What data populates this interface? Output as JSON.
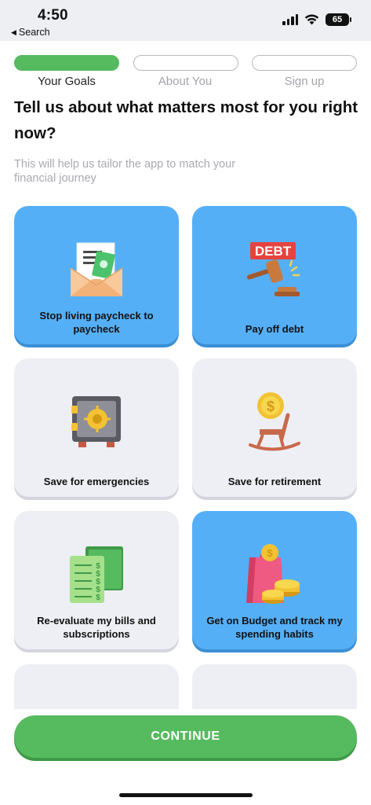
{
  "status_bar": {
    "time": "4:50",
    "back_label": "Search",
    "battery": "65"
  },
  "steps": [
    {
      "label": "Your Goals",
      "active": true
    },
    {
      "label": "About You",
      "active": false
    },
    {
      "label": "Sign up",
      "active": false
    }
  ],
  "heading": "Tell us about what matters most for you right now?",
  "subtitle": "This will help us tailor the app to match your financial journey",
  "goals": [
    {
      "label": "Stop living paycheck to paycheck",
      "selected": true,
      "icon": "money-envelope-icon"
    },
    {
      "label": "Pay off debt",
      "selected": true,
      "icon": "debt-gavel-icon",
      "icon_text": "DEBT"
    },
    {
      "label": "Save for emergencies",
      "selected": false,
      "icon": "safe-icon"
    },
    {
      "label": "Save for retirement",
      "selected": false,
      "icon": "rocking-chair-coin-icon"
    },
    {
      "label": "Re-evaluate my bills and subscriptions",
      "selected": false,
      "icon": "bills-icon"
    },
    {
      "label": "Get on Budget and track my spending habits",
      "selected": true,
      "icon": "shopping-bag-coins-icon"
    }
  ],
  "continue_label": "CONTINUE",
  "colors": {
    "accent_green": "#55bb5e",
    "selected_blue": "#55aff7",
    "card_grey": "#eeeff4"
  }
}
